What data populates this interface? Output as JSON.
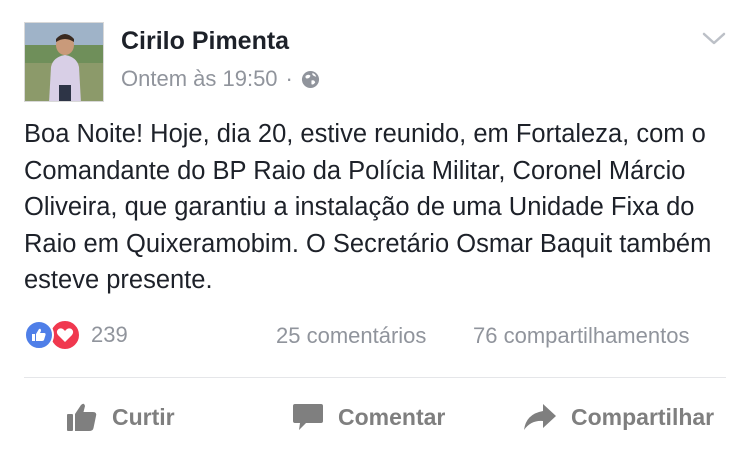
{
  "post": {
    "author": "Cirilo Pimenta",
    "timestamp": "Ontem às 19:50",
    "separator": "·",
    "privacy_icon": "globe-icon",
    "menu_icon": "chevron-down-icon",
    "text": "Boa Noite! Hoje, dia 20, estive reunido, em Fortaleza, com o Comandante do BP Raio da Polícia Militar, Coronel Márcio Oliveira, que garantiu a instalação de uma Unidade Fixa do Raio em Quixeramobim. O Secretário Osmar Baquit também esteve presente."
  },
  "stats": {
    "reaction_icons": [
      "like-reaction-icon",
      "love-reaction-icon"
    ],
    "reactions_count": "239",
    "comments": "25 comentários",
    "shares": "76 compartilhamentos"
  },
  "actions": {
    "like": "Curtir",
    "comment": "Comentar",
    "share": "Compartilhar"
  },
  "colors": {
    "like_blue": "#4f7fe8",
    "love_red": "#f0384f",
    "secondary_text": "#90949c",
    "action_text": "#7f7f7f"
  }
}
